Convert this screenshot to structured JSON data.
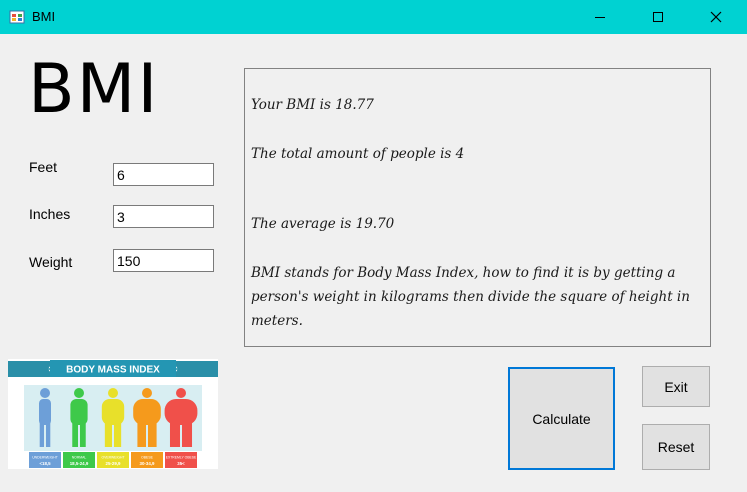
{
  "window": {
    "title": "BMI",
    "icon": "winforms-app-icon",
    "controls": [
      "minimize-icon",
      "maximize-icon",
      "close-icon"
    ]
  },
  "heading": "BMI",
  "form": {
    "feet": {
      "label": "Feet",
      "value": "6"
    },
    "inches": {
      "label": "Inches",
      "value": "3"
    },
    "weight": {
      "label": "Weight",
      "value": "150"
    }
  },
  "output": {
    "bmi_line": "Your BMI is 18.77",
    "people_line": "The total amount of people is 4",
    "average_line": "The average is 19.70",
    "description": "BMI stands for Body Mass Index, how to find it is by getting a person's weight in kilograms then divide the square of height in meters."
  },
  "buttons": {
    "calculate": "Calculate",
    "exit": "Exit",
    "reset": "Reset"
  },
  "chart_image": {
    "banner": "BODY MASS INDEX",
    "categories": [
      {
        "label": "UNDERWEIGHT",
        "range": "<18,5",
        "color": "#6d9fd8"
      },
      {
        "label": "NORMAL",
        "range": "18,5-24,9",
        "color": "#3ec94a"
      },
      {
        "label": "OVERWEIGHT",
        "range": "25-29,9",
        "color": "#e8e02a"
      },
      {
        "label": "OBESE",
        "range": "30-34,9",
        "color": "#f59a1c"
      },
      {
        "label": "EXTREMLY OBESE",
        "range": "35<",
        "color": "#f0504a"
      }
    ]
  }
}
